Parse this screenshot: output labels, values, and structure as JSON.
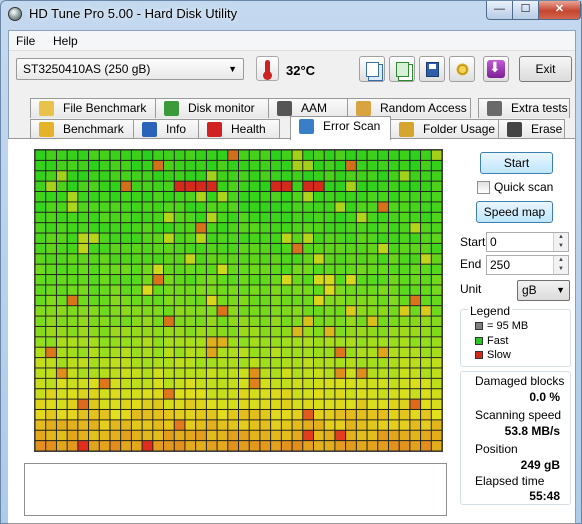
{
  "window": {
    "title": "HD Tune Pro 5.00 - Hard Disk Utility",
    "controls": {
      "minimize": "—",
      "maximize": "☐",
      "close": "✕"
    }
  },
  "menu": {
    "file": "File",
    "help": "Help"
  },
  "toolbar": {
    "drive": "ST3250410AS (250 gB)",
    "temperature": "32°C",
    "exit_label": "Exit"
  },
  "tabs": {
    "row1": [
      {
        "label": "File Benchmark",
        "icon": "file-benchmark-icon"
      },
      {
        "label": "Disk monitor",
        "icon": "disk-monitor-icon"
      },
      {
        "label": "AAM",
        "icon": "speaker-icon"
      },
      {
        "label": "Random Access",
        "icon": "random-access-icon"
      },
      {
        "label": "Extra tests",
        "icon": "extra-tests-icon"
      }
    ],
    "row2": [
      {
        "label": "Benchmark",
        "icon": "benchmark-icon"
      },
      {
        "label": "Info",
        "icon": "info-icon"
      },
      {
        "label": "Health",
        "icon": "health-cross-icon"
      },
      {
        "label": "Error Scan",
        "icon": "magnifier-icon"
      },
      {
        "label": "Folder Usage",
        "icon": "folder-icon"
      },
      {
        "label": "Erase",
        "icon": "trash-icon"
      }
    ],
    "active": "Error Scan"
  },
  "scan": {
    "start_label": "Start",
    "quick_scan_label": "Quick scan",
    "quick_scan_checked": false,
    "speed_map_label": "Speed map",
    "start_field_label": "Start",
    "start_value": "0",
    "end_field_label": "End",
    "end_value": "250",
    "unit_label": "Unit",
    "unit_value": "gB",
    "map": {
      "columns": 38,
      "rows": 29,
      "slow_blocks": [
        [
          3,
          13
        ],
        [
          3,
          14
        ],
        [
          3,
          15
        ],
        [
          3,
          16
        ],
        [
          3,
          22
        ],
        [
          3,
          23
        ],
        [
          3,
          25
        ],
        [
          3,
          26
        ]
      ],
      "colors": {
        "fast": "#2ec426",
        "slow": "#d42a1c",
        "grid": "#3a3a3a"
      }
    }
  },
  "legend": {
    "title": "Legend",
    "items": [
      {
        "label": "= 95 MB",
        "color": "#808080"
      },
      {
        "label": "Fast",
        "color": "#2ec426"
      },
      {
        "label": "Slow",
        "color": "#d42a1c"
      }
    ]
  },
  "stats": {
    "damaged_label": "Damaged blocks",
    "damaged_value": "0.0 %",
    "speed_label": "Scanning speed",
    "speed_value": "53.8 MB/s",
    "position_label": "Position",
    "position_value": "249 gB",
    "elapsed_label": "Elapsed time",
    "elapsed_value": "55:48"
  }
}
